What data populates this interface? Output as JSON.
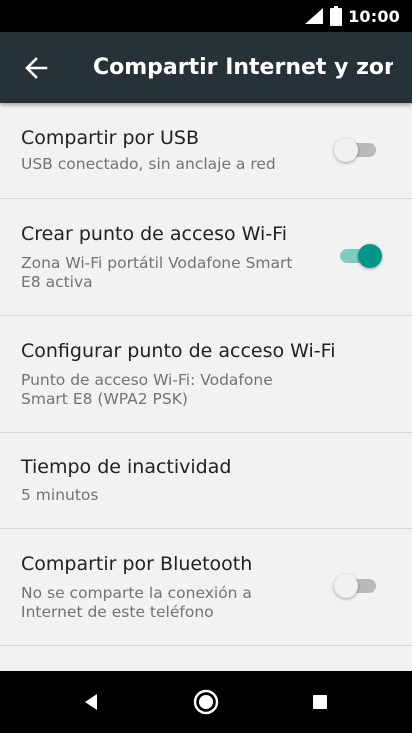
{
  "status_bar": {
    "time": "10:00",
    "icons": [
      "signal-icon",
      "battery-icon"
    ]
  },
  "app_bar": {
    "title": "Compartir Internet y zona Wi-Fi",
    "back_icon": "arrow-back-icon",
    "background": "#263238"
  },
  "settings": {
    "items": [
      {
        "title": "Compartir por USB",
        "summary": "USB conectado, sin anclaje a red",
        "toggle": "off"
      },
      {
        "title": "Crear punto de acceso Wi-Fi",
        "summary": "Zona Wi-Fi portátil Vodafone Smart E8 activa",
        "toggle": "on"
      },
      {
        "title": "Configurar punto de acceso Wi-Fi",
        "summary": "Punto de acceso Wi-Fi: Vodafone Smart E8 (WPA2 PSK)"
      },
      {
        "title": "Tiempo de inactividad",
        "summary": "5 minutos"
      },
      {
        "title": "Compartir por Bluetooth",
        "summary": "No se comparte la conexión a Internet de este teléfono",
        "toggle": "off"
      }
    ]
  },
  "colors": {
    "accent": "#009688",
    "accent_track": "#80cbc4",
    "background": "#f2f2f2",
    "title_text": "#212121",
    "summary_text": "#737373"
  },
  "nav_bar": {
    "icons": [
      "back-triangle-icon",
      "home-circle-icon",
      "recents-square-icon"
    ]
  }
}
